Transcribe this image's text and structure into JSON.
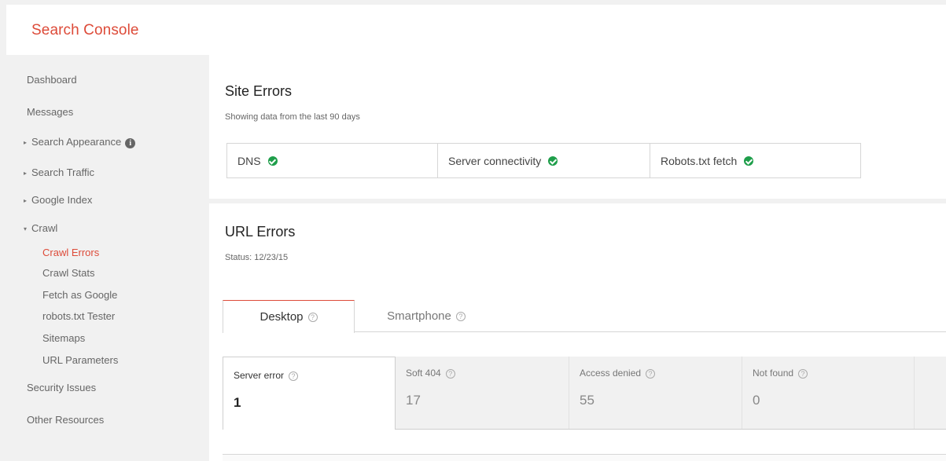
{
  "app": {
    "title": "Search Console"
  },
  "sidebar": {
    "items": [
      {
        "label": "Dashboard"
      },
      {
        "label": "Messages"
      },
      {
        "label": "Search Appearance"
      },
      {
        "label": "Search Traffic"
      },
      {
        "label": "Google Index"
      },
      {
        "label": "Crawl"
      },
      {
        "label": "Security Issues"
      },
      {
        "label": "Other Resources"
      }
    ],
    "crawl_items": [
      {
        "label": "Crawl Errors"
      },
      {
        "label": "Crawl Stats"
      },
      {
        "label": "Fetch as Google"
      },
      {
        "label": "robots.txt Tester"
      },
      {
        "label": "Sitemaps"
      },
      {
        "label": "URL Parameters"
      }
    ],
    "active_item": "Crawl Errors",
    "info_glyph": "i"
  },
  "site_errors": {
    "title": "Site Errors",
    "subtitle": "Showing data from the last 90 days",
    "checks": [
      {
        "label": "DNS",
        "status_icon": "check-icon"
      },
      {
        "label": "Server connectivity",
        "status_icon": "check-icon"
      },
      {
        "label": "Robots.txt fetch",
        "status_icon": "check-icon"
      }
    ]
  },
  "url_errors": {
    "title": "URL Errors",
    "status": "Status: 12/23/15",
    "tabs": [
      {
        "label": "Desktop",
        "active": true
      },
      {
        "label": "Smartphone",
        "active": false
      }
    ],
    "help_glyph": "?",
    "stats": [
      {
        "label": "Server error",
        "value": "1",
        "active": true
      },
      {
        "label": "Soft 404",
        "value": "17",
        "active": false
      },
      {
        "label": "Access denied",
        "value": "55",
        "active": false
      },
      {
        "label": "Not found",
        "value": "0",
        "active": false
      }
    ]
  },
  "colors": {
    "brand": "#dd4b39",
    "check": "#1e9e4a",
    "background": "#f1f1f1"
  }
}
